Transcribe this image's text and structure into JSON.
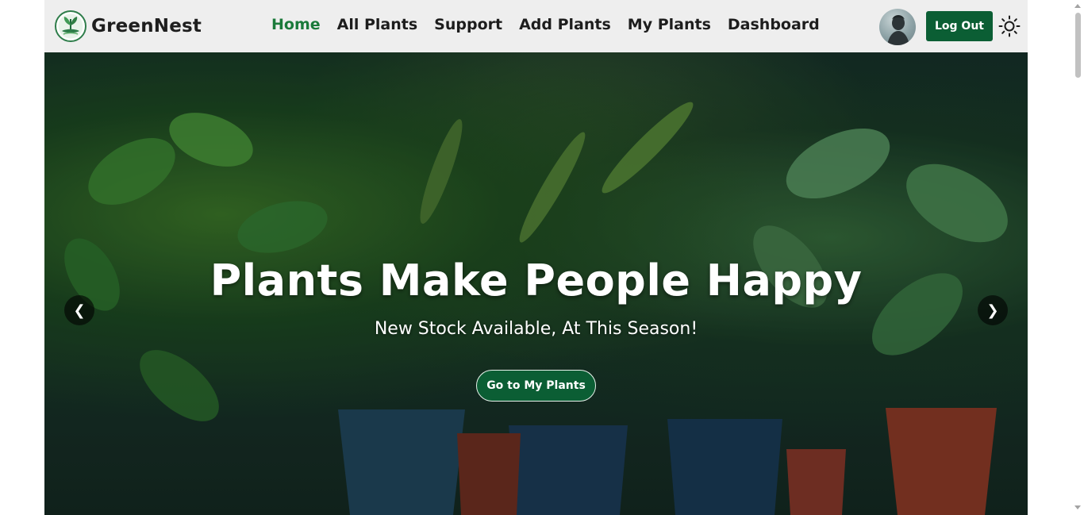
{
  "brand": {
    "name": "GreenNest",
    "logo_icon": "leaf-logo-icon"
  },
  "nav": {
    "items": [
      {
        "label": "Home",
        "active": true
      },
      {
        "label": "All Plants",
        "active": false
      },
      {
        "label": "Support",
        "active": false
      },
      {
        "label": "Add Plants",
        "active": false
      },
      {
        "label": "My Plants",
        "active": false
      },
      {
        "label": "Dashboard",
        "active": false
      }
    ],
    "logout_label": "Log Out",
    "theme_icon": "sun-icon"
  },
  "hero": {
    "title": "Plants Make People Happy",
    "subtitle": "New Stock Available, At This Season!",
    "cta_label": "Go to My Plants",
    "prev_arrow": "❮",
    "next_arrow": "❯"
  },
  "colors": {
    "accent": "#0b5e34",
    "active_nav": "#1a7a3a",
    "navbar_bg": "#eeeeee"
  }
}
